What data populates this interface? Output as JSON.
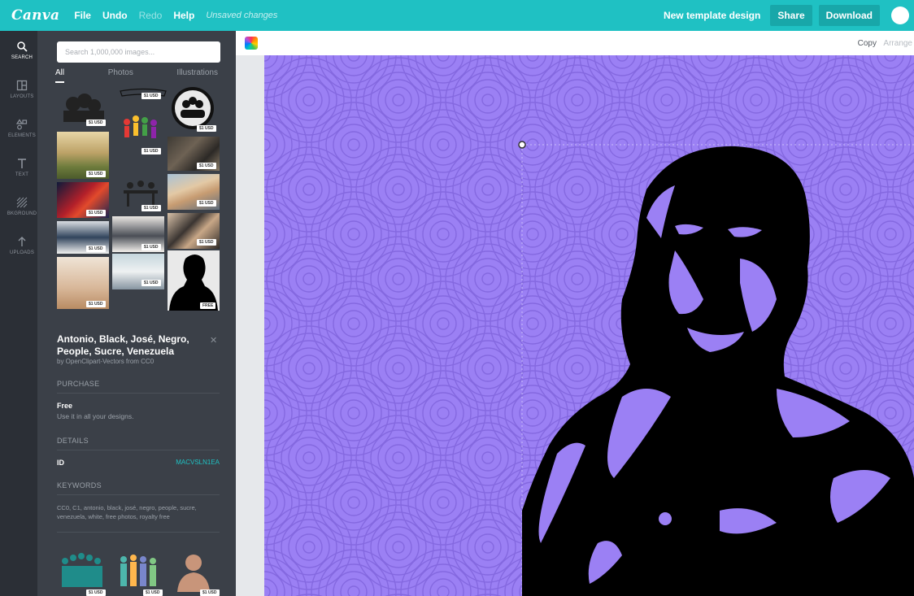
{
  "topbar": {
    "logo": "Canva",
    "menu": {
      "file": "File",
      "undo": "Undo",
      "redo": "Redo",
      "help": "Help"
    },
    "status": "Unsaved changes",
    "design_title": "New template design",
    "share": "Share",
    "download": "Download"
  },
  "rail": {
    "items": [
      {
        "label": "SEARCH",
        "icon": "search-icon"
      },
      {
        "label": "LAYOUTS",
        "icon": "layouts-icon"
      },
      {
        "label": "ELEMENTS",
        "icon": "elements-icon"
      },
      {
        "label": "TEXT",
        "icon": "text-icon"
      },
      {
        "label": "BKGROUND",
        "icon": "background-icon"
      },
      {
        "label": "UPLOADS",
        "icon": "upload-icon"
      }
    ]
  },
  "panel": {
    "search_placeholder": "Search 1,000,000 images...",
    "tabs": [
      "All",
      "Photos",
      "Illustrations"
    ],
    "price_tag": "$1 USD",
    "free_tag": "FREE",
    "detail": {
      "title": "Antonio, Black, José, Negro, People, Sucre, Venezuela",
      "credit": "by OpenClipart-Vectors from CC0",
      "purchase_heading": "PURCHASE",
      "price_name": "Free",
      "price_desc": "Use it in all your designs.",
      "details_heading": "DETAILS",
      "id_label": "ID",
      "id_value": "MACVSLN1EA",
      "keywords_heading": "KEYWORDS",
      "keywords": "CC0, C1, antonio, black, josé, negro, people, sucre, venezuela, white, free photos, royalty free"
    }
  },
  "workspace": {
    "copy": "Copy",
    "arrange": "Arrange"
  },
  "colors": {
    "topbar": "#1fc1c3",
    "panel": "#3b4048",
    "rail": "#2b2f36",
    "canvas_bg": "#9b80f4",
    "silhouette": "#000000",
    "accent": "#1fc1c3"
  }
}
